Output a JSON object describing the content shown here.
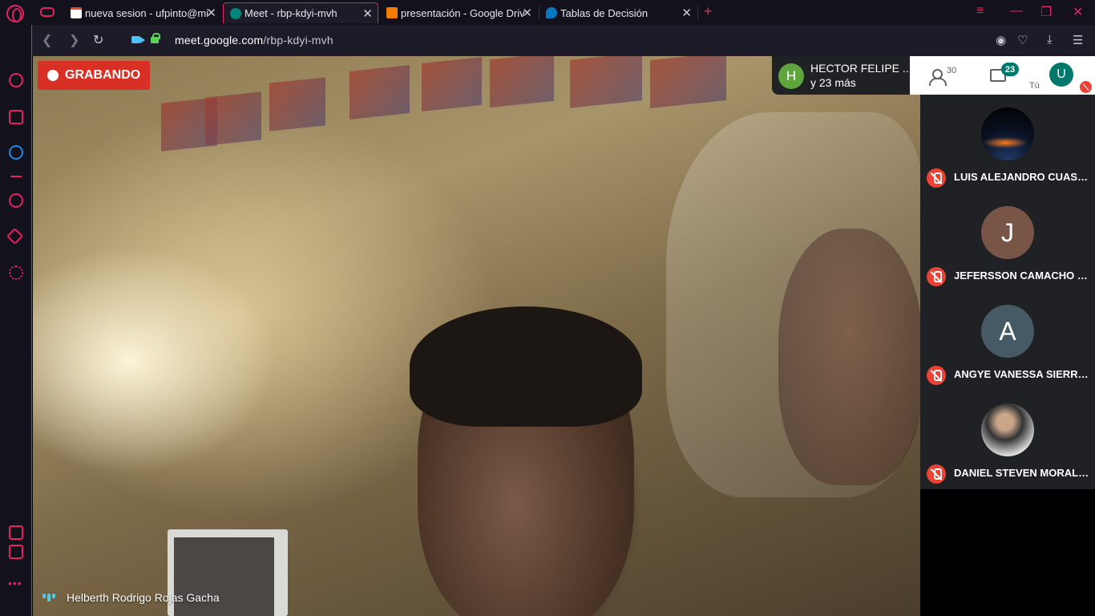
{
  "browser": {
    "tabs": [
      {
        "title": "nueva sesion - ufpinto@mi",
        "favicon": "gmail-icon",
        "active": false
      },
      {
        "title": "Meet - rbp-kdyi-mvh",
        "favicon": "meet-icon",
        "active": true
      },
      {
        "title": "presentación - Google Driv",
        "favicon": "presentation-icon",
        "active": false
      },
      {
        "title": "Tablas de Decisión",
        "favicon": "drupal-icon",
        "active": false
      }
    ],
    "close_glyph": "✕",
    "new_tab_glyph": "+",
    "url_domain": "meet.google.com",
    "url_path": "/rbp-kdyi-mvh",
    "accent_color": "#e3235d"
  },
  "meet": {
    "recording_label": "GRABANDO",
    "speaker_name": "Helberth Rodrigo Rojas Gacha",
    "host_initial": "H",
    "host_name": "HECTOR FELIPE ...",
    "host_more": "y 23 más",
    "people_count": "30",
    "chat_badge": "23",
    "you_initial": "U",
    "you_label": "Tú",
    "participants": [
      {
        "name": "LUIS ALEJANDRO CUASQ...",
        "initial": "",
        "avatar_color": "#000000"
      },
      {
        "name": "JEFERSSON CAMACHO R...",
        "initial": "J",
        "avatar_color": "#795548"
      },
      {
        "name": "ANGYE VANESSA SIERRA ...",
        "initial": "A",
        "avatar_color": "#455a64"
      },
      {
        "name": "DANIEL STEVEN MORALE...",
        "initial": "",
        "avatar_color": "#9e9e9e"
      }
    ]
  }
}
